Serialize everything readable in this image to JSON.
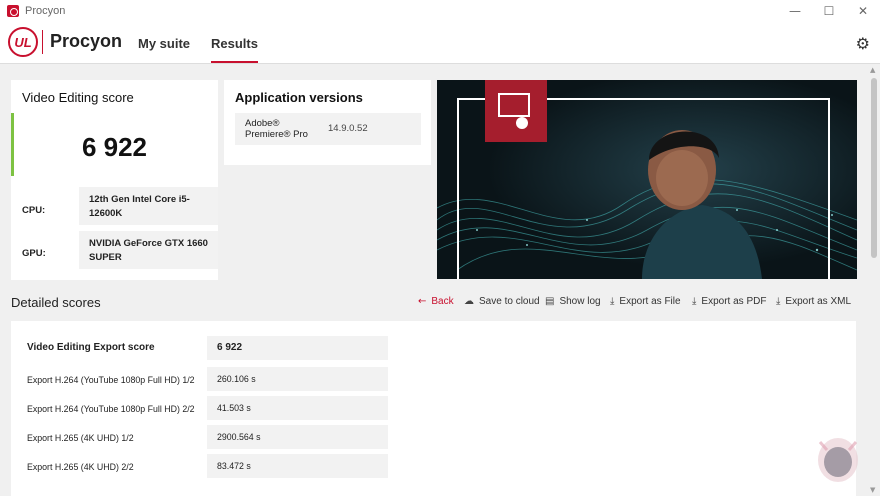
{
  "window": {
    "title": "Procyon",
    "controls": {
      "minimize": "—",
      "maximize": "☐",
      "close": "✕"
    }
  },
  "header": {
    "logo_text": "UL",
    "brand": "Procyon",
    "nav": [
      {
        "label": "My suite"
      },
      {
        "label": "Results"
      }
    ],
    "active_tab": "Results"
  },
  "score_card": {
    "title": "Video Editing score",
    "score": "6 922",
    "cpu_label": "CPU:",
    "cpu_value": "12th Gen Intel Core i5-12600K",
    "gpu_label": "GPU:",
    "gpu_value": "NVIDIA GeForce GTX 1660 SUPER",
    "accent_color": "#7dc242"
  },
  "app_versions": {
    "title": "Application versions",
    "items": [
      {
        "name": "Adobe® Premiere® Pro",
        "version": "14.9.0.52"
      }
    ]
  },
  "detailed": {
    "title": "Detailed scores",
    "actions": [
      {
        "label": "Back",
        "icon": "arrow-left-icon"
      },
      {
        "label": "Save to cloud",
        "icon": "cloud-upload-icon"
      },
      {
        "label": "Show log",
        "icon": "document-icon"
      },
      {
        "label": "Export as File",
        "icon": "download-icon"
      },
      {
        "label": "Export as PDF",
        "icon": "download-icon"
      },
      {
        "label": "Export as XML",
        "icon": "download-icon"
      }
    ],
    "rows": [
      {
        "label": "Video Editing Export score",
        "value": "6 922"
      },
      {
        "label": "Export H.264 (YouTube 1080p Full HD) 1/2",
        "value": "260.106 s"
      },
      {
        "label": "Export H.264 (YouTube 1080p Full HD) 2/2",
        "value": "41.503 s"
      },
      {
        "label": "Export H.265 (4K UHD) 1/2",
        "value": "2900.564 s"
      },
      {
        "label": "Export H.265 (4K UHD) 2/2",
        "value": "83.472 s"
      }
    ]
  },
  "colors": {
    "brand_red": "#c8102e",
    "accent_green": "#7dc242",
    "panel_bg": "#f2f2f2"
  }
}
